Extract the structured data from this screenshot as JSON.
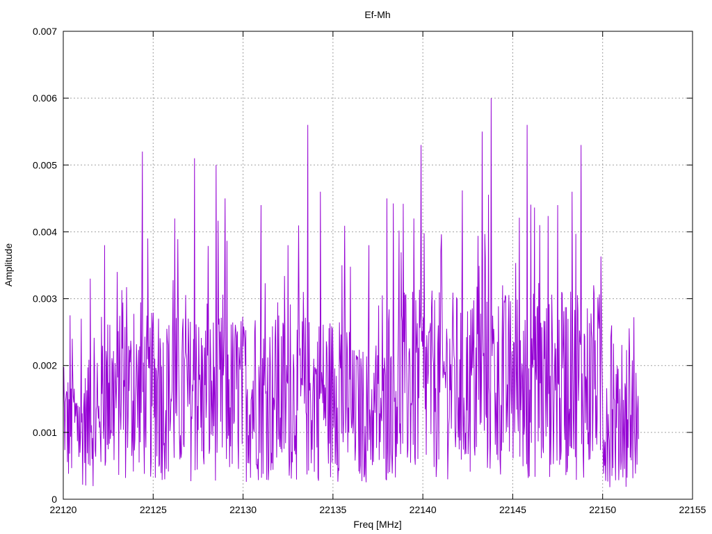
{
  "chart_data": {
    "type": "line",
    "title": "Ef-Mh",
    "xlabel": "Freq [MHz]",
    "ylabel": "Amplitude",
    "xlim": [
      22120,
      22155
    ],
    "ylim": [
      0,
      0.007
    ],
    "x_ticks": [
      "22120",
      "22125",
      "22130",
      "22135",
      "22140",
      "22145",
      "22150",
      "22155"
    ],
    "y_ticks": [
      "0",
      "0.001",
      "0.002",
      "0.003",
      "0.004",
      "0.005",
      "0.006",
      "0.007"
    ],
    "grid": true,
    "legend": "none",
    "series": [
      {
        "color": "#9400d3",
        "x_range": [
          22120,
          22152
        ],
        "note_envelope": "dense noise-like spectrum; representative peak values below",
        "peaks": [
          {
            "x": 22120.2,
            "y": 0.0016
          },
          {
            "x": 22120.5,
            "y": 0.0024
          },
          {
            "x": 22121.0,
            "y": 0.0027
          },
          {
            "x": 22121.5,
            "y": 0.0033
          },
          {
            "x": 22122.3,
            "y": 0.0038
          },
          {
            "x": 22123.0,
            "y": 0.0034
          },
          {
            "x": 22124.4,
            "y": 0.0052
          },
          {
            "x": 22124.7,
            "y": 0.0039
          },
          {
            "x": 22125.3,
            "y": 0.0027
          },
          {
            "x": 22126.2,
            "y": 0.0042
          },
          {
            "x": 22127.3,
            "y": 0.0051
          },
          {
            "x": 22128.5,
            "y": 0.005
          },
          {
            "x": 22129.0,
            "y": 0.0045
          },
          {
            "x": 22131.0,
            "y": 0.0044
          },
          {
            "x": 22132.5,
            "y": 0.0038
          },
          {
            "x": 22133.6,
            "y": 0.0056
          },
          {
            "x": 22134.3,
            "y": 0.0046
          },
          {
            "x": 22135.5,
            "y": 0.0035
          },
          {
            "x": 22137.0,
            "y": 0.0038
          },
          {
            "x": 22138.0,
            "y": 0.0045
          },
          {
            "x": 22139.5,
            "y": 0.0042
          },
          {
            "x": 22139.9,
            "y": 0.0053
          },
          {
            "x": 22141.0,
            "y": 0.0037
          },
          {
            "x": 22143.3,
            "y": 0.0055
          },
          {
            "x": 22143.8,
            "y": 0.006
          },
          {
            "x": 22145.8,
            "y": 0.0056
          },
          {
            "x": 22146.5,
            "y": 0.0041
          },
          {
            "x": 22147.5,
            "y": 0.0044
          },
          {
            "x": 22148.3,
            "y": 0.0046
          },
          {
            "x": 22148.8,
            "y": 0.0053
          },
          {
            "x": 22149.5,
            "y": 0.0032
          },
          {
            "x": 22150.5,
            "y": 0.0026
          },
          {
            "x": 22151.5,
            "y": 0.0022
          },
          {
            "x": 22152.0,
            "y": 0.0009
          }
        ]
      }
    ]
  }
}
